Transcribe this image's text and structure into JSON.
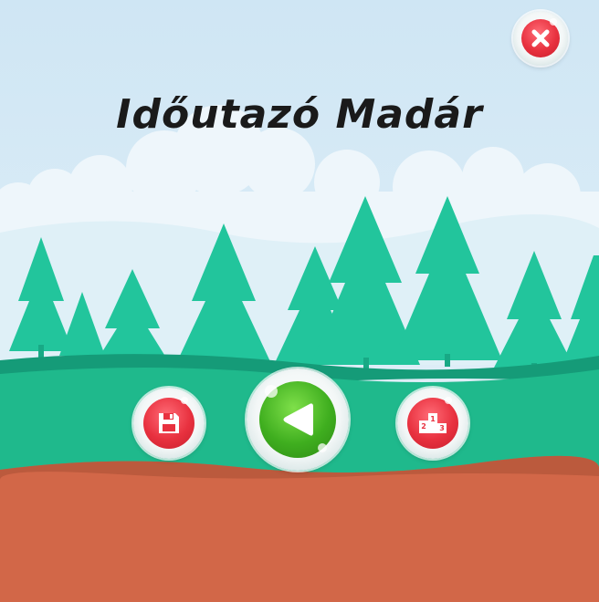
{
  "game": {
    "title": "Időutazó Madár"
  },
  "buttons": {
    "close_icon": "close-icon",
    "save_icon": "floppy-disk-icon",
    "play_icon": "back-arrow-icon",
    "leaderboard_icon": "podium-icon",
    "podium_labels": [
      "1",
      "2",
      "3"
    ]
  },
  "colors": {
    "sky": "#d8ecf7",
    "cloud": "#eaf5fb",
    "tree": "#1fc69a",
    "grass": "#1fb98c",
    "grass_dark": "#169b76",
    "soil": "#d26748",
    "button_red": "#e8313f",
    "button_green": "#3fae1f"
  }
}
